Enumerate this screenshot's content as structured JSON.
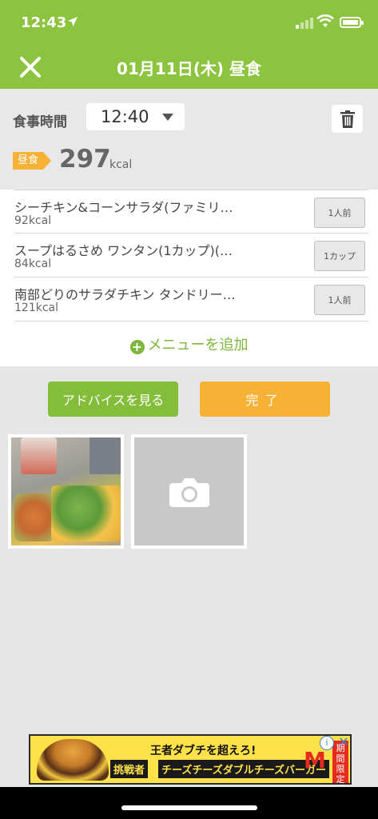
{
  "status_bar": {
    "time": "12:43"
  },
  "nav": {
    "title": "01月11日(木) 昼食"
  },
  "meal_time": {
    "label": "食事時間",
    "value": "12:40"
  },
  "summary": {
    "meal_badge": "昼食",
    "kcal_value": "297",
    "kcal_unit": "kcal"
  },
  "menu_items": [
    {
      "name": "シーチキン&コーンサラダ(ファミリ…",
      "kcal": "92kcal",
      "portion": "1人前"
    },
    {
      "name": "スープはるさめ ワンタン(1カップ)(…",
      "kcal": "84kcal",
      "portion": "1カップ"
    },
    {
      "name": "南部どりのサラダチキン タンドリー…",
      "kcal": "121kcal",
      "portion": "1人前"
    }
  ],
  "add_menu_label": "メニューを追加",
  "buttons": {
    "advice": "アドバイスを見る",
    "done": "完了"
  },
  "ad": {
    "line1": "王者ダブチを超えろ!",
    "tag": "挑戦者",
    "line2": "チーズチーズダブルチーズバーガー",
    "logo": "M",
    "limited": "期間限定"
  },
  "colors": {
    "brand_green": "#8cc43f",
    "accent_orange": "#f7b236"
  }
}
